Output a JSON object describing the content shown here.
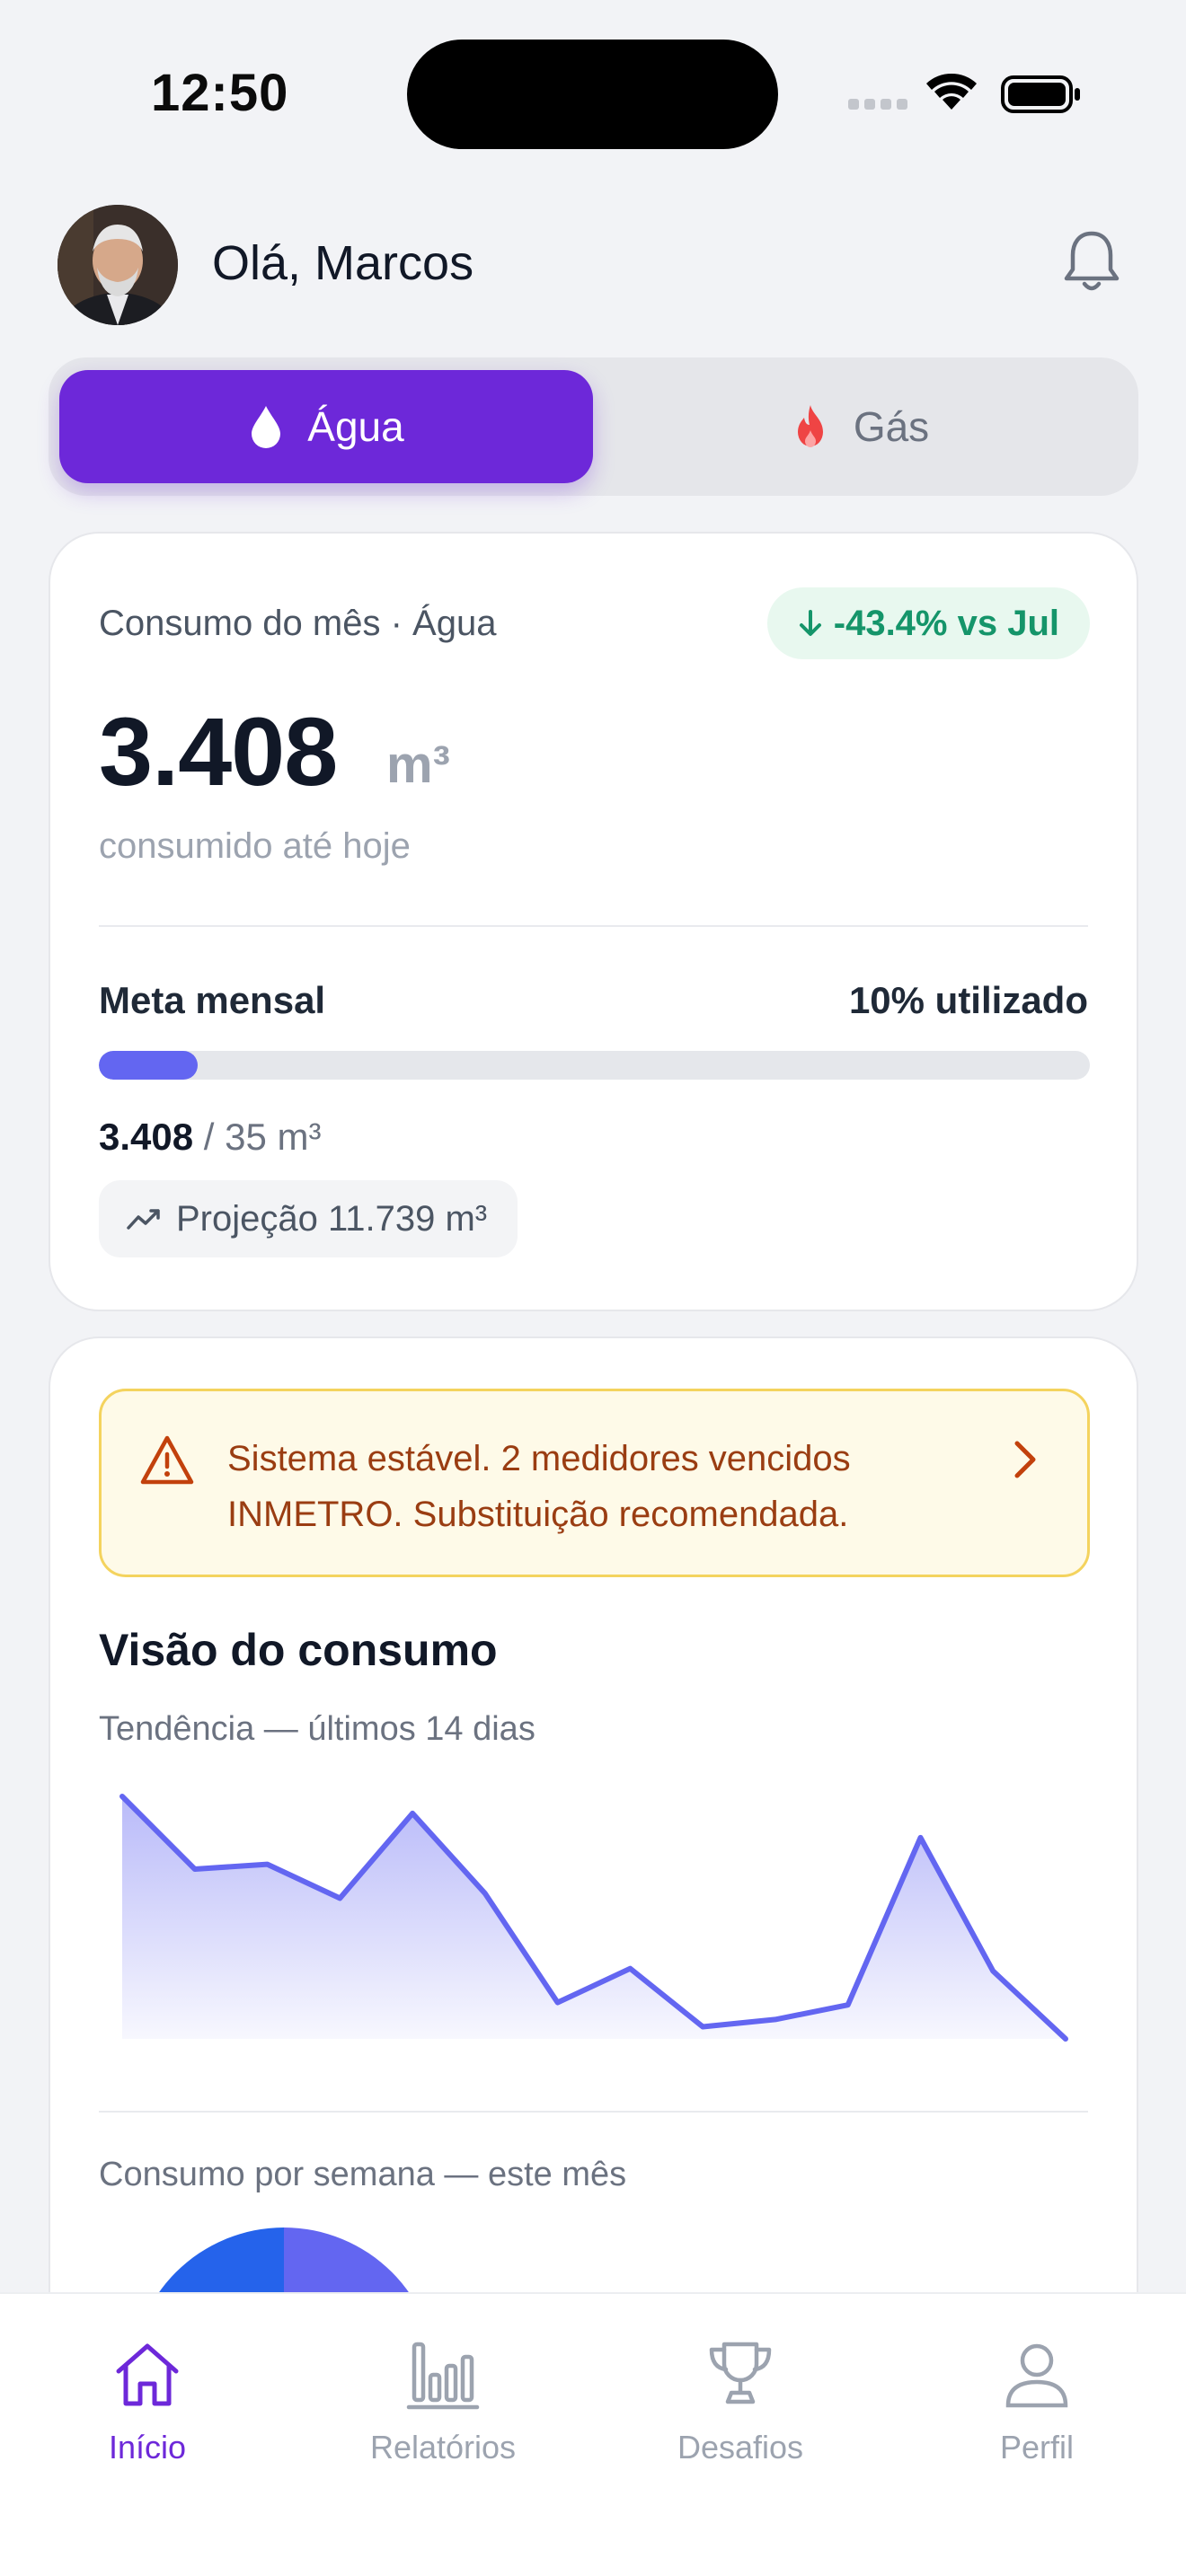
{
  "status_bar": {
    "time": "12:50"
  },
  "header": {
    "greeting": "Olá, Marcos"
  },
  "toggle": {
    "water_label": "Água",
    "gas_label": "Gás",
    "selected": "water"
  },
  "consumption_card": {
    "title": "Consumo do mês · Água",
    "delta_badge": "-43.4% vs Jul",
    "value": "3.408",
    "unit": "m³",
    "subtitle": "consumido até hoje",
    "goal_label": "Meta mensal",
    "goal_used": "10% utilizado",
    "goal_progress_percent": 10,
    "usage_current": "3.408",
    "usage_total": "/ 35 m³",
    "projection": "Projeção 11.739 m³"
  },
  "overview_card": {
    "alert_text": "Sistema estável. 2 medidores vencidos INMETRO. Substituição recomendada.",
    "section_title": "Visão do consumo",
    "trend_label": "Tendência — últimos 14 dias",
    "weekly_label": "Consumo por semana — este mês"
  },
  "chart_data": {
    "type": "area",
    "title": "Tendência — últimos 14 dias",
    "x": [
      1,
      2,
      3,
      4,
      5,
      6,
      7,
      8,
      9,
      10,
      11,
      12,
      13,
      14
    ],
    "values": [
      100,
      70,
      72,
      58,
      93,
      60,
      15,
      29,
      5,
      8,
      14,
      83,
      28,
      0
    ],
    "ylim": [
      0,
      100
    ],
    "grid": false,
    "legend": "none",
    "color": "#6366f1"
  },
  "tabbar": {
    "items": [
      {
        "label": "Início",
        "icon": "home-icon",
        "active": true
      },
      {
        "label": "Relatórios",
        "icon": "bar-chart-icon",
        "active": false
      },
      {
        "label": "Desafios",
        "icon": "trophy-icon",
        "active": false
      },
      {
        "label": "Perfil",
        "icon": "user-icon",
        "active": false
      }
    ]
  },
  "colors": {
    "accent": "#6d28d9",
    "chart": "#6366f1",
    "success": "#15956a",
    "warning_text": "#9a3d12",
    "warning_border": "#f4d35e",
    "gas_icon": "#ef4444"
  }
}
